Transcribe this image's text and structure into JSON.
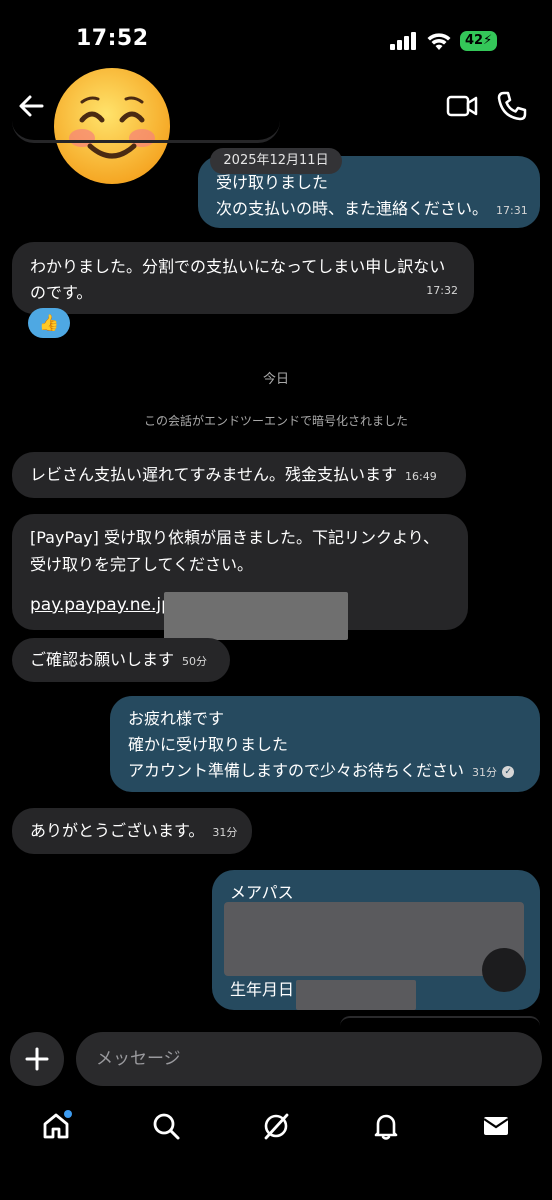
{
  "status_bar": {
    "time": "17:52",
    "battery": "42"
  },
  "header": {
    "avatar_emoji": "😊"
  },
  "messages": {
    "prev_date": "2025年12月11日",
    "out1": {
      "line1": "受け取りました",
      "line2": "次の支払いの時、また連絡ください。",
      "time": "17:31"
    },
    "in1": {
      "line1": "わかりました。分割での支払いになってしまい申し訳ない",
      "line2": "のです。",
      "time": "17:32",
      "reaction": "👍"
    },
    "today_label": "今日",
    "encryption_notice": "この会話がエンドツーエンドで暗号化されました",
    "in2": {
      "text": "レビさん支払い遅れてすみません。残金支払います",
      "time": "16:49"
    },
    "in3": {
      "line1": "[PayPay] 受け取り依頼が届きました。下記リンクより、",
      "line2": "受け取りを完了してください。",
      "link": "pay.paypay.ne.jp/"
    },
    "in4": {
      "text": "ご確認お願いします",
      "time": "50分"
    },
    "out2": {
      "line1": "お疲れ様です",
      "line2": "確かに受け取りました",
      "line3": "アカウント準備しますので少々お待ちください",
      "time": "31分"
    },
    "in5": {
      "text": "ありがとうございます。",
      "time": "31分"
    },
    "out3": {
      "line1": "メアパス",
      "line2": "生年月日"
    }
  },
  "composer": {
    "placeholder": "メッセージ"
  }
}
